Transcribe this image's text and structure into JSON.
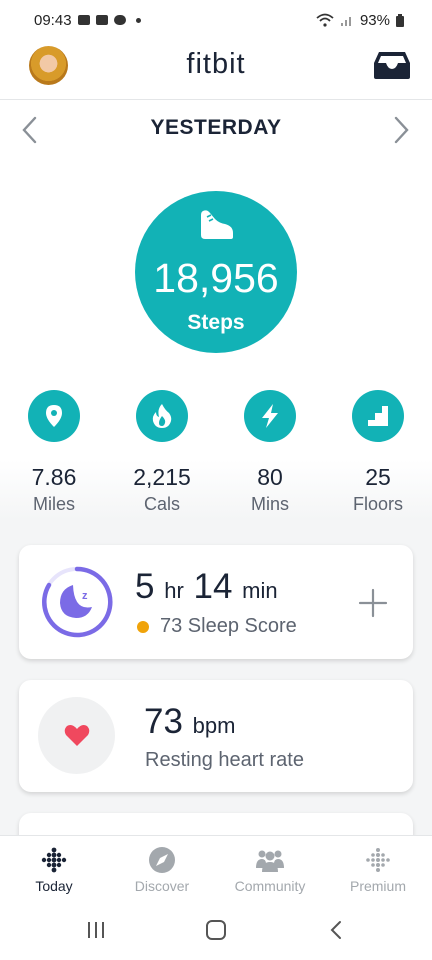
{
  "status_bar": {
    "time": "09:43",
    "battery": "93%"
  },
  "header": {
    "app_title": "fitbit"
  },
  "date_nav": {
    "label": "YESTERDAY"
  },
  "steps": {
    "value": "18,956",
    "unit": "Steps"
  },
  "stats": [
    {
      "value": "7.86",
      "label": "Miles",
      "icon": "location-pin-icon"
    },
    {
      "value": "2,215",
      "label": "Cals",
      "icon": "flame-icon"
    },
    {
      "value": "80",
      "label": "Mins",
      "icon": "lightning-icon"
    },
    {
      "value": "25",
      "label": "Floors",
      "icon": "stairs-icon"
    }
  ],
  "sleep_card": {
    "hours": "5",
    "hours_unit": "hr",
    "minutes": "14",
    "minutes_unit": "min",
    "score_text": "73 Sleep Score",
    "score_color": "#f0a30a"
  },
  "heart_card": {
    "value": "73",
    "unit": "bpm",
    "label": "Resting heart rate"
  },
  "bottom_nav": [
    {
      "label": "Today",
      "active": true
    },
    {
      "label": "Discover",
      "active": false
    },
    {
      "label": "Community",
      "active": false
    },
    {
      "label": "Premium",
      "active": false
    }
  ],
  "colors": {
    "accent": "#12b2b6",
    "sleep": "#7b6be6",
    "heart": "#f0485e"
  }
}
